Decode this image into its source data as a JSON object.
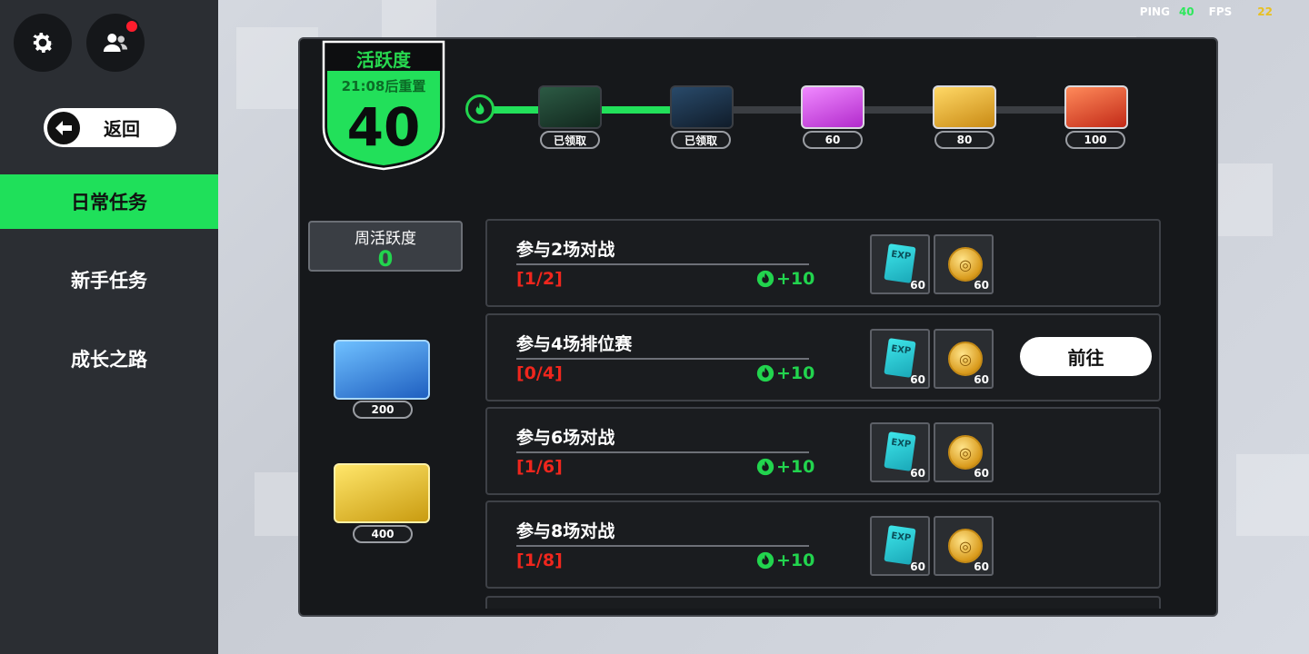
{
  "status": {
    "ping_label": "PING",
    "ping_value": "40",
    "fps_label": "FPS",
    "fps_value": "22"
  },
  "sidebar": {
    "back_label": "返回",
    "items": [
      {
        "label": "日常任务",
        "active": true
      },
      {
        "label": "新手任务",
        "active": false
      },
      {
        "label": "成长之路",
        "active": false
      }
    ]
  },
  "activity": {
    "title": "活跃度",
    "reset_text": "21:08后重置",
    "value": "40",
    "milestones": [
      {
        "label": "已领取",
        "color": "#1f5a3a"
      },
      {
        "label": "已领取",
        "color": "#1f3c5a"
      },
      {
        "label": "60",
        "color": "#c43fd6"
      },
      {
        "label": "80",
        "color": "#e4a92a"
      },
      {
        "label": "100",
        "color": "#e0472c"
      }
    ]
  },
  "weekly": {
    "label": "周活跃度",
    "value": "0",
    "chests": [
      {
        "label": "200",
        "color": "#2f7fd6"
      },
      {
        "label": "400",
        "color": "#e8c22a"
      }
    ]
  },
  "tasks": [
    {
      "title": "参与2场对战",
      "progress": "[1/2]",
      "points": "+10",
      "rewards": [
        "60",
        "60"
      ],
      "go": ""
    },
    {
      "title": "参与4场排位赛",
      "progress": "[0/4]",
      "points": "+10",
      "rewards": [
        "60",
        "60"
      ],
      "go": "前往"
    },
    {
      "title": "参与6场对战",
      "progress": "[1/6]",
      "points": "+10",
      "rewards": [
        "60",
        "60"
      ],
      "go": ""
    },
    {
      "title": "参与8场对战",
      "progress": "[1/8]",
      "points": "+10",
      "rewards": [
        "60",
        "60"
      ],
      "go": ""
    }
  ],
  "reward_icons": {
    "exp_text": "EXP"
  },
  "colors": {
    "accent": "#1fe05a",
    "progress_red": "#f0261d"
  }
}
